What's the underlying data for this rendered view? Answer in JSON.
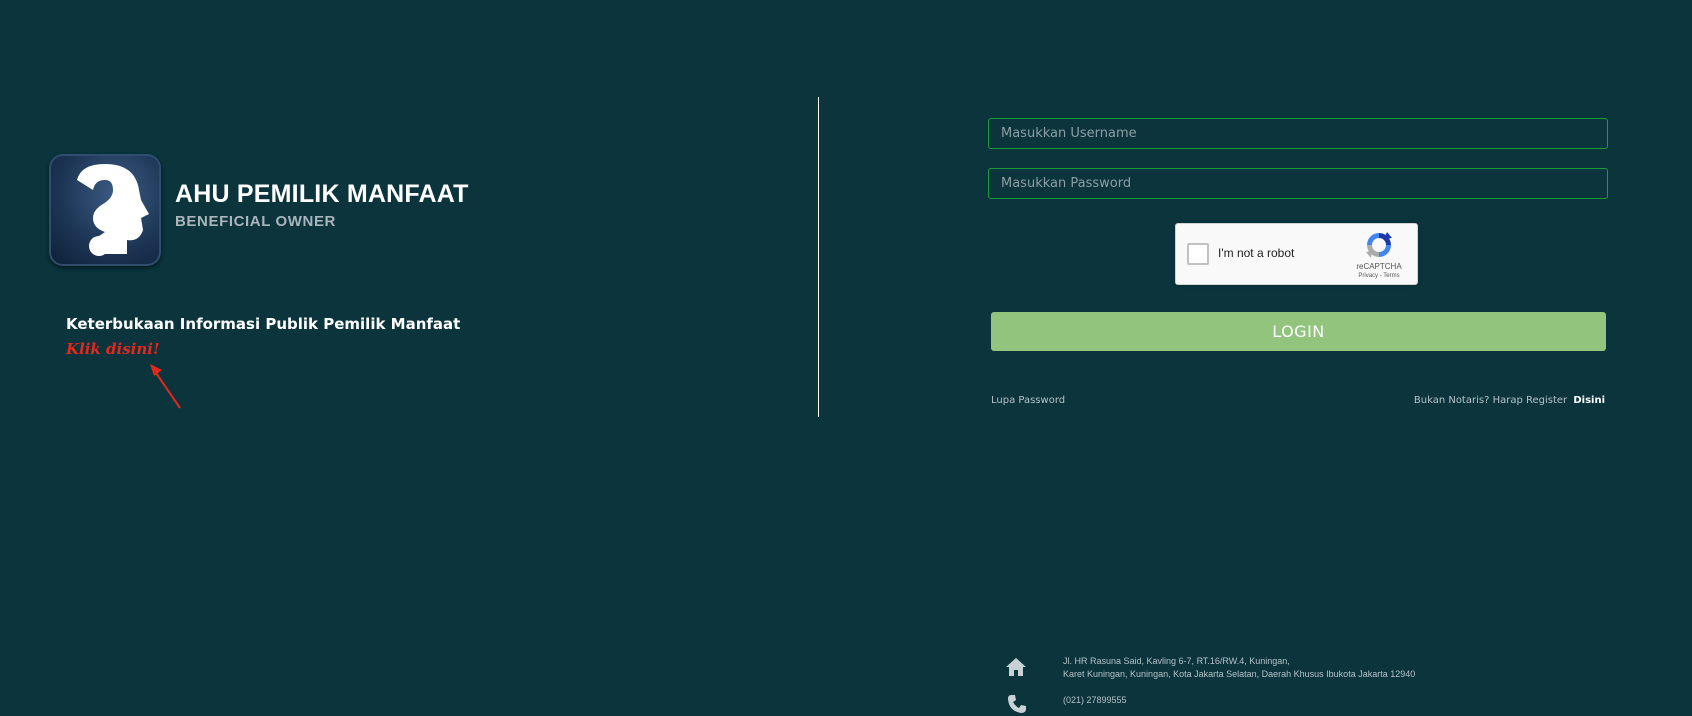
{
  "brand": {
    "title": "AHU PEMILIK MANFAAT",
    "subtitle": "BENEFICIAL OWNER"
  },
  "info": {
    "title": "Keterbukaan Informasi Publik Pemilik Manfaat",
    "link_label": "Klik disini!"
  },
  "login_form": {
    "username_placeholder": "Masukkan Username",
    "password_placeholder": "Masukkan Password",
    "recaptcha": {
      "label": "I'm not a robot",
      "brand": "reCAPTCHA",
      "links": "Privacy - Terms"
    },
    "login_label": "LOGIN",
    "forgot_password": "Lupa Password",
    "register_prompt": "Bukan Notaris? Harap Register",
    "register_link": "Disini"
  },
  "footer": {
    "address_line1": "Jl. HR Rasuna Said, Kavling 6-7, RT.16/RW.4, Kuningan,",
    "address_line2": "Karet Kuningan, Kuningan, Kota Jakarta Selatan, Daerah Khusus Ibukota Jakarta 12940",
    "phone": "(021) 27899555"
  },
  "icons": {
    "logo": "question-head-icon",
    "arrow": "red-arrow-icon",
    "home": "home-icon",
    "phone": "phone-icon"
  },
  "colors": {
    "background": "#0b343d",
    "input_border": "#1f9a3b",
    "login_button": "#92c47e",
    "link_red": "#e4281c"
  }
}
